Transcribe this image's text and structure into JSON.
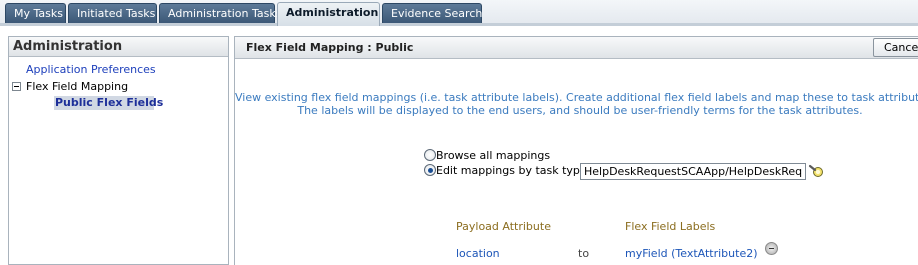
{
  "tabs": [
    {
      "label": "My Tasks"
    },
    {
      "label": "Initiated Tasks"
    },
    {
      "label": "Administration Tasks"
    },
    {
      "label": "Administration",
      "active": true
    },
    {
      "label": "Evidence Search"
    }
  ],
  "sidebar": {
    "title": "Administration",
    "items": [
      {
        "label": "Application Preferences"
      },
      {
        "label": "Flex Field Mapping"
      },
      {
        "label": "Public Flex Fields",
        "selected": true
      }
    ]
  },
  "main": {
    "title": "Flex Field Mapping : Public",
    "cancel_label": "Cancel",
    "description_line1": "View existing flex field mappings (i.e. task attribute labels). Create additional flex field labels and map these to task attributes.",
    "description_line2": "The labels will be displayed to the end users, and should be user-friendly terms for the task attributes.",
    "options": {
      "browse_label": "Browse all mappings",
      "edit_label": "Edit mappings by task type:",
      "selected": "edit"
    },
    "task_type_value": "HelpDeskRequestSCAApp/HelpDeskRequestC",
    "table": {
      "headers": [
        "Payload Attribute",
        "Flex Field Labels"
      ],
      "rows": [
        {
          "attribute": "location",
          "connector": "to",
          "label": "myField (TextAttribute2)"
        }
      ]
    }
  },
  "icons": {
    "browse": "flashlight-icon",
    "remove": "remove-icon",
    "tree_toggle": "collapse-icon"
  },
  "colors": {
    "tab_bg": "#3a5675",
    "link": "#1d3fbb",
    "description": "#3b7bbf",
    "column_header": "#8b6d1f"
  }
}
